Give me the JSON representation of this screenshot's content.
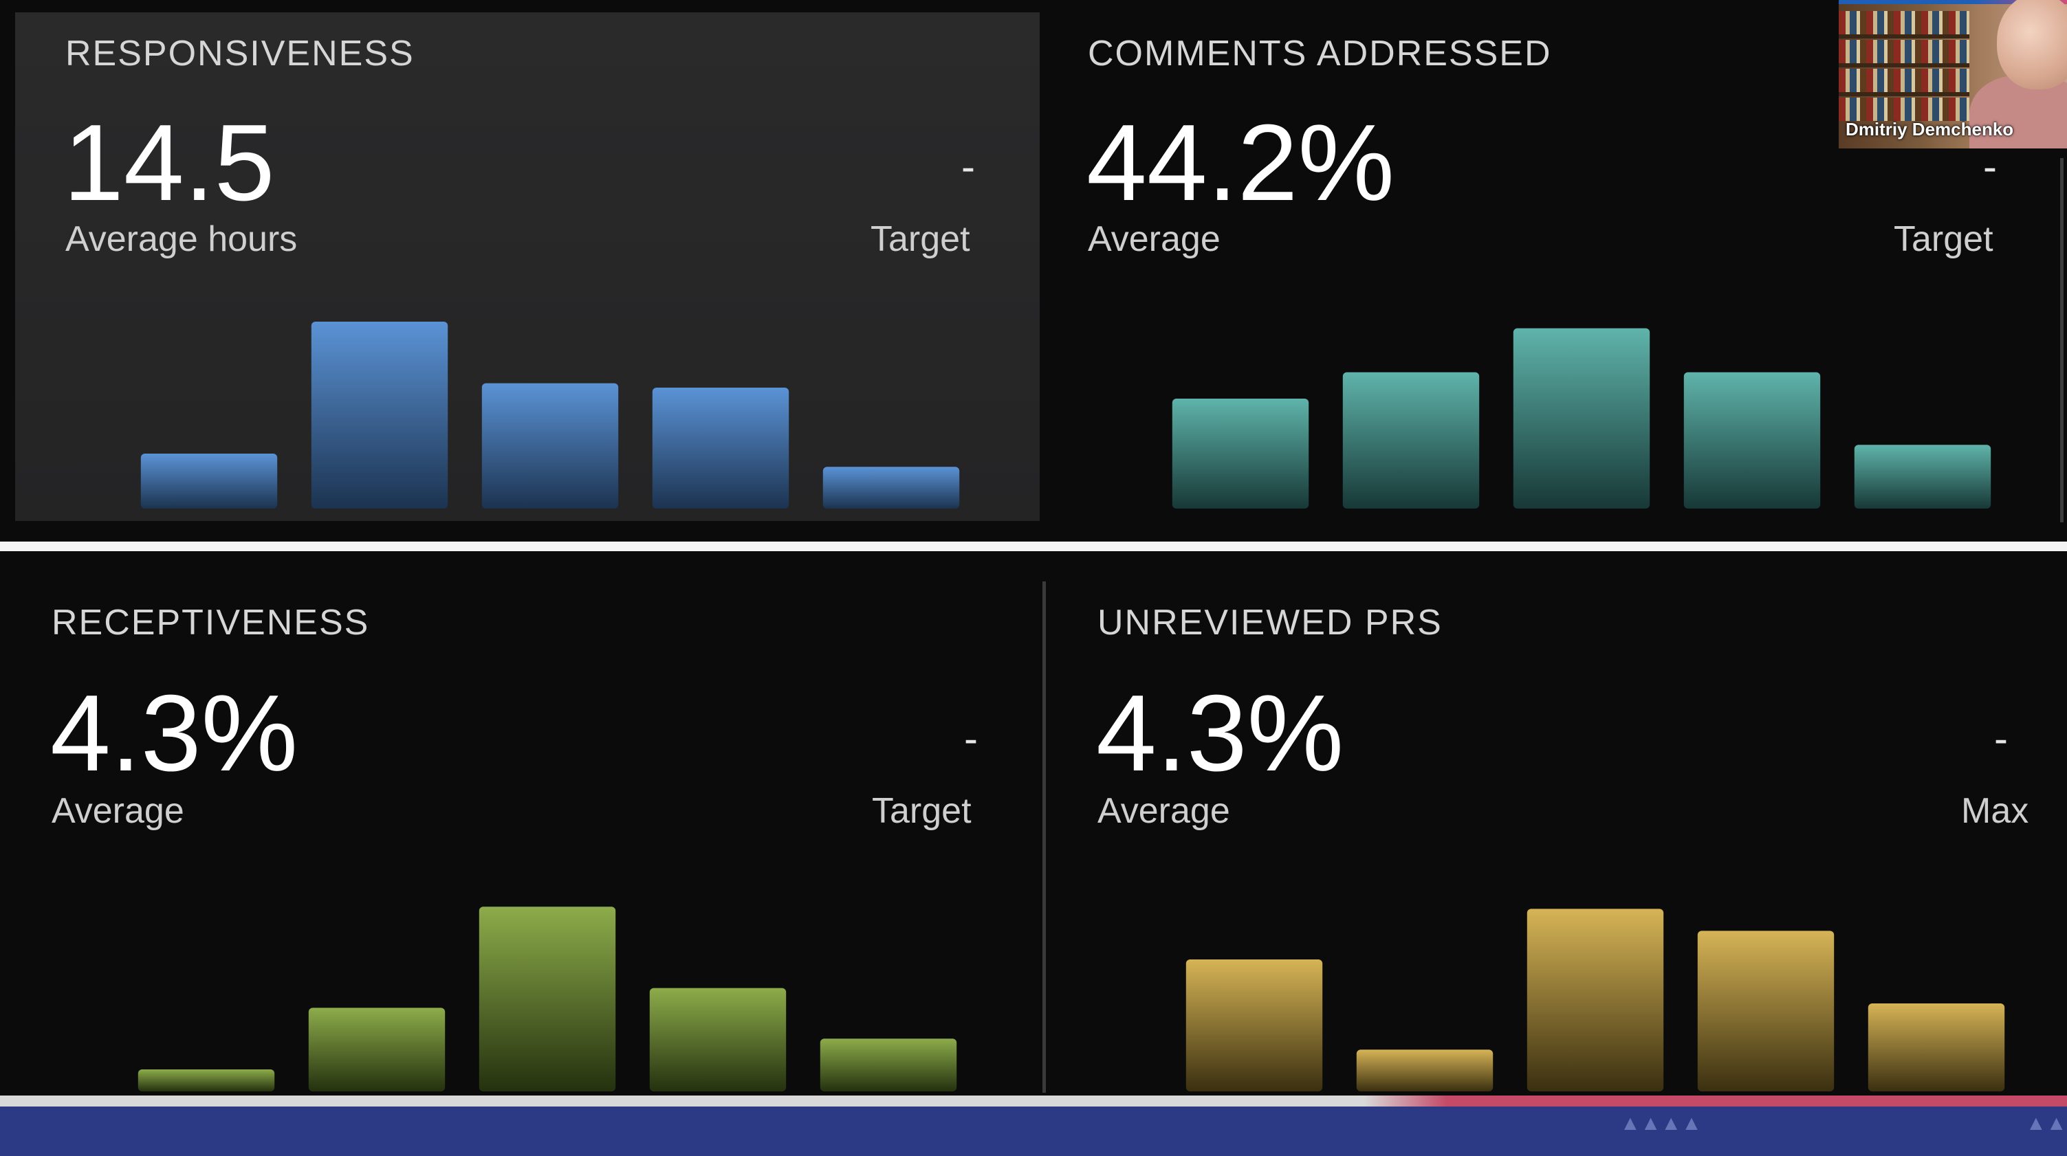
{
  "panels": {
    "responsiveness": {
      "title": "RESPONSIVENESS",
      "value": "14.5",
      "sub": "Average hours",
      "target_value": "-",
      "target_label": "Target"
    },
    "comments": {
      "title": "COMMENTS ADDRESSED",
      "value": "44.2%",
      "sub": "Average",
      "target_value": "-",
      "target_label": "Target"
    },
    "receptiveness": {
      "title": "RECEPTIVENESS",
      "value": "4.3%",
      "sub": "Average",
      "target_value": "-",
      "target_label": "Target"
    },
    "unreviewed": {
      "title": "UNREVIEWED PRS",
      "value": "4.3%",
      "sub": "Average",
      "target_value": "-",
      "target_label": "Max"
    }
  },
  "video": {
    "participant_name": "Dmitriy Demchenko"
  },
  "chart_data": [
    {
      "type": "bar",
      "values": [
        0.25,
        0.85,
        0.57,
        0.55,
        0.19
      ],
      "ylim": [
        0,
        1
      ],
      "colors": {
        "top": "#5b93d6",
        "bottom": "#1c3350"
      }
    },
    {
      "type": "bar",
      "values": [
        0.5,
        0.62,
        0.82,
        0.62,
        0.29
      ],
      "ylim": [
        0,
        1
      ],
      "colors": {
        "top": "#5fb4ab",
        "bottom": "#173836"
      }
    },
    {
      "type": "bar",
      "values": [
        0.1,
        0.38,
        0.84,
        0.47,
        0.24
      ],
      "ylim": [
        0,
        1
      ],
      "colors": {
        "top": "#8dac4a",
        "bottom": "#24310f"
      }
    },
    {
      "type": "bar",
      "values": [
        0.6,
        0.19,
        0.83,
        0.73,
        0.4
      ],
      "ylim": [
        0,
        1
      ],
      "colors": {
        "top": "#d6b456",
        "bottom": "#3a2f10"
      }
    }
  ]
}
